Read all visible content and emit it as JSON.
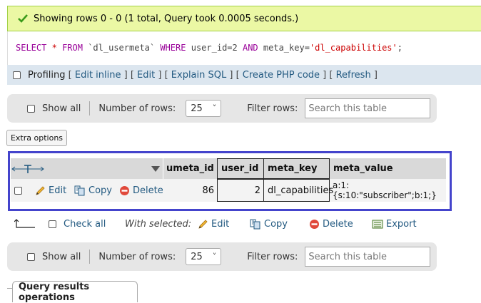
{
  "success": {
    "message": "Showing rows 0 - 0 (1 total, Query took 0.0005 seconds.)",
    "icon": "check-icon"
  },
  "sql": {
    "select": "SELECT",
    "star": "*",
    "from": "FROM",
    "table": "`dl_usermeta`",
    "where": "WHERE",
    "cond1": "user_id=2",
    "and": "AND",
    "cond2_key": "meta_key=",
    "cond2_val": "'dl_capabilities'",
    "end": ";"
  },
  "profiling": {
    "label": "Profiling",
    "links": {
      "edit_inline": "Edit inline",
      "edit": "Edit",
      "explain": "Explain SQL",
      "create_php": "Create PHP code",
      "refresh": "Refresh"
    }
  },
  "nav_top": {
    "show_all": "Show all",
    "rows_label": "Number of rows:",
    "rows_value": "25",
    "filter_label": "Filter rows:",
    "search_placeholder": "Search this table"
  },
  "extra_options": "Extra options",
  "table": {
    "headers": {
      "umeta_id": "umeta_id",
      "user_id": "user_id",
      "meta_key": "meta_key",
      "meta_value": "meta_value"
    },
    "row": {
      "edit": "Edit",
      "copy": "Copy",
      "delete": "Delete",
      "umeta_id": "86",
      "user_id": "2",
      "meta_key": "dl_capabilities",
      "meta_value": "a:1:{s:10:\"subscriber\";b:1;}"
    }
  },
  "bottom": {
    "check_all": "Check all",
    "with_selected": "With selected:",
    "edit": "Edit",
    "copy": "Copy",
    "delete": "Delete",
    "export": "Export"
  },
  "nav_bottom": {
    "show_all": "Show all",
    "rows_label": "Number of rows:",
    "rows_value": "25",
    "filter_label": "Filter rows:",
    "search_placeholder": "Search this table"
  },
  "query_results_ops": "Query results operations",
  "colors": {
    "success_bg": "#ebf8a4",
    "link": "#235a81",
    "highlight": "#4444cc",
    "keyword": "#990099",
    "string": "#cc0000"
  }
}
